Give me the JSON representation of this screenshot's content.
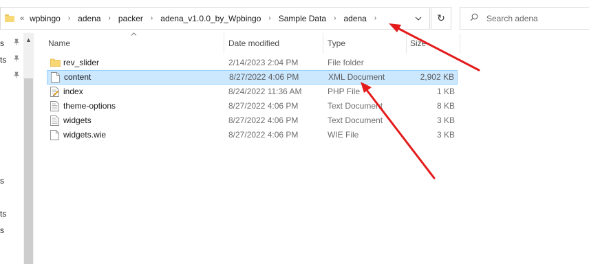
{
  "address_bar": {
    "overflow": "«",
    "breadcrumbs": [
      "wpbingo",
      "adena",
      "packer",
      "adena_v1.0.0_by_Wpbingo",
      "Sample Data",
      "adena"
    ],
    "separator": "›",
    "dropdown_icon": "chevron-down-icon",
    "refresh_icon": "refresh-icon"
  },
  "search": {
    "placeholder": "Search adena",
    "icon": "search-icon"
  },
  "nav_pane": {
    "fragments": [
      "s",
      "ts",
      "s",
      "ts",
      "s"
    ]
  },
  "columns": {
    "name": "Name",
    "date": "Date modified",
    "type": "Type",
    "size": "Size"
  },
  "files": [
    {
      "name": "rev_slider",
      "date": "2/14/2023 2:04 PM",
      "type": "File folder",
      "size": "",
      "icon": "folder-icon",
      "selected": false
    },
    {
      "name": "content",
      "date": "8/27/2022 4:06 PM",
      "type": "XML Document",
      "size": "2,902 KB",
      "icon": "file-icon",
      "selected": true
    },
    {
      "name": "index",
      "date": "8/24/2022 11:36 AM",
      "type": "PHP File",
      "size": "1 KB",
      "icon": "php-file-icon",
      "selected": false
    },
    {
      "name": "theme-options",
      "date": "8/27/2022 4:06 PM",
      "type": "Text Document",
      "size": "8 KB",
      "icon": "text-file-icon",
      "selected": false
    },
    {
      "name": "widgets",
      "date": "8/27/2022 4:06 PM",
      "type": "Text Document",
      "size": "3 KB",
      "icon": "text-file-icon",
      "selected": false
    },
    {
      "name": "widgets.wie",
      "date": "8/27/2022 4:06 PM",
      "type": "WIE File",
      "size": "3 KB",
      "icon": "file-icon",
      "selected": false
    }
  ],
  "annotation_color": "#e31b1b"
}
